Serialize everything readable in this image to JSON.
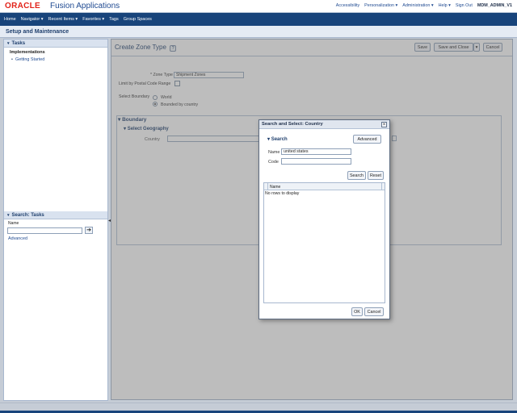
{
  "header": {
    "logo": "ORACLE",
    "product": "Fusion Applications",
    "links": [
      "Accessibility",
      "Personalization ▾",
      "Administration ▾",
      "Help ▾",
      "Sign Out"
    ],
    "user": "MDM_ADMIN_V1"
  },
  "nav": {
    "items": [
      "Home",
      "Navigator ▾",
      "Recent Items ▾",
      "Favorites ▾",
      "Tags",
      "Group Spaces"
    ]
  },
  "page": {
    "title": "Setup and Maintenance"
  },
  "left_panel": {
    "tasks_title": "Tasks",
    "implementations": "Implementations",
    "getting_started": "Getting Started",
    "search_title": "Search: Tasks",
    "name_label": "Name",
    "search_value": "",
    "go_icon": "arrow-right-icon",
    "advanced": "Advanced"
  },
  "main": {
    "title": "Create Zone Type",
    "help_icon": "question-icon",
    "buttons": {
      "save": "Save",
      "save_close": "Save and Close",
      "cancel": "Cancel"
    },
    "zone_type_label": "* Zone Type",
    "zone_type_value": "Shipment Zones",
    "postal_label": "Limit by Postal Code Range",
    "boundary_label": "Select Boundary",
    "world_label": "World",
    "bounded_label": "Bounded by country",
    "boundary_section": "Boundary",
    "select_geography": "Select Geography",
    "country_label": "Country"
  },
  "dialog": {
    "title": "Search and Select: Country",
    "search_header": "Search",
    "advanced_button": "Advanced",
    "name_label": "Name",
    "name_value": "united states",
    "code_label": "Code",
    "code_value": "",
    "search_button": "Search",
    "reset_button": "Reset",
    "table_header": "Name",
    "no_rows": "No rows to display",
    "ok_button": "OK",
    "cancel_button": "Cancel"
  },
  "colors": {
    "nav_bg": "#18447b",
    "brand_red": "#e2231a",
    "link_blue": "#1f4a91",
    "panel_header": "#d9e2ef",
    "overlay": "#8a8a8a"
  }
}
